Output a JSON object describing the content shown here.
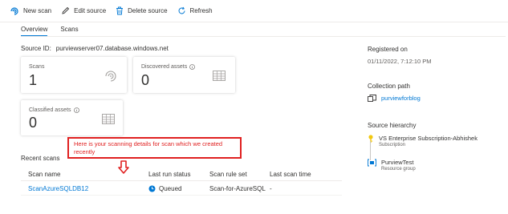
{
  "toolbar": {
    "new_scan": "New scan",
    "edit_source": "Edit source",
    "delete_source": "Delete source",
    "refresh": "Refresh"
  },
  "tabs": [
    {
      "label": "Overview",
      "active": true
    },
    {
      "label": "Scans",
      "active": false
    }
  ],
  "source": {
    "label": "Source ID:",
    "value": "purviewserver07.database.windows.net"
  },
  "cards": {
    "scans": {
      "label": "Scans",
      "value": "1"
    },
    "discovered": {
      "label": "Discovered assets",
      "value": "0"
    },
    "classified": {
      "label": "Classified assets",
      "value": "0"
    }
  },
  "recent_scans": {
    "title": "Recent scans",
    "columns": [
      "Scan name",
      "Last run status",
      "Scan rule set",
      "Last scan time"
    ],
    "rows": [
      {
        "name": "ScanAzureSQLDB12",
        "status": "Queued",
        "rule_set": "Scan-for-AzureSQL",
        "last_scan": "-"
      }
    ]
  },
  "callout": {
    "text": "Here is your scanning details for scan which we created recently"
  },
  "right_panel": {
    "registered_label": "Registered on",
    "registered_value": "01/11/2022, 7:12:10 PM",
    "collection_label": "Collection path",
    "collection_value": "purviewforblog",
    "hierarchy_label": "Source hierarchy",
    "hierarchy": [
      {
        "name": "VS Enterprise Subscription-Abhishek",
        "type": "Subscription"
      },
      {
        "name": "PurviewTest",
        "type": "Resource group"
      }
    ]
  },
  "colors": {
    "accent": "#0078d4",
    "callout": "#e02020",
    "key_icon": "#f2c811"
  }
}
